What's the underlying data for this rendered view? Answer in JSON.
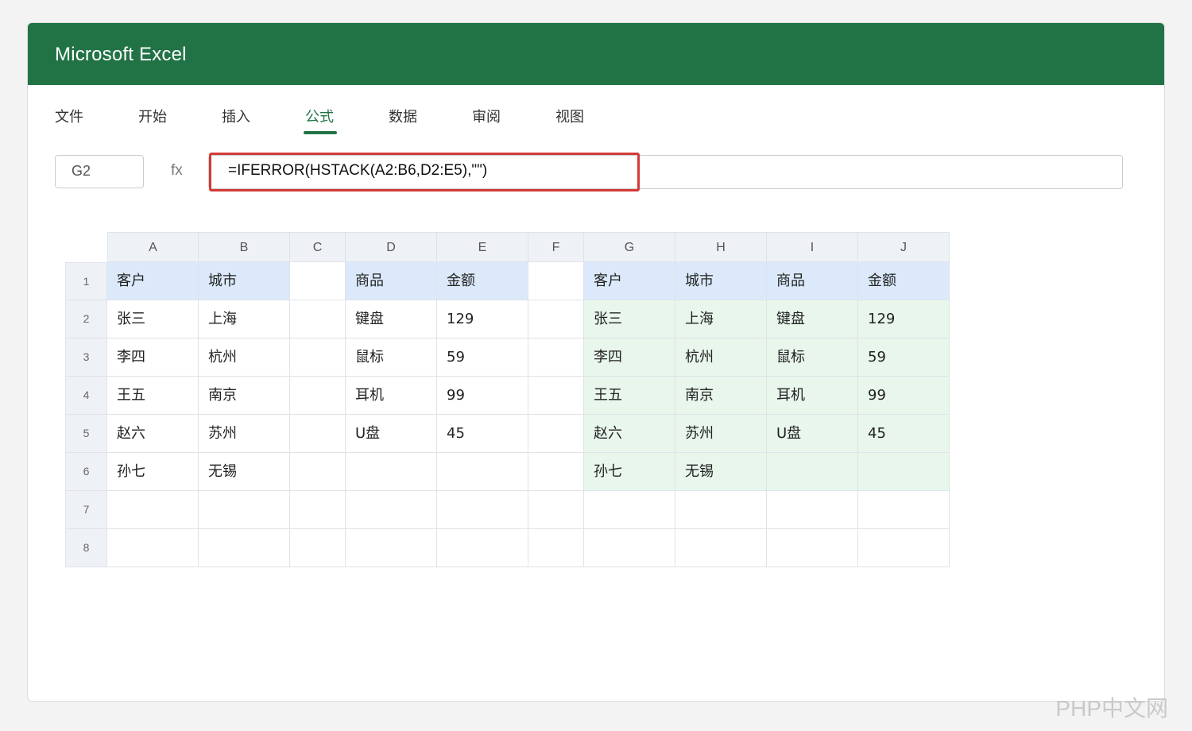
{
  "app": {
    "title": "Microsoft Excel"
  },
  "ribbon": {
    "tabs": [
      {
        "label": "文件"
      },
      {
        "label": "开始"
      },
      {
        "label": "插入"
      },
      {
        "label": "公式",
        "active": true
      },
      {
        "label": "数据"
      },
      {
        "label": "审阅"
      },
      {
        "label": "视图"
      }
    ]
  },
  "formula": {
    "name_box": "G2",
    "fx_label": "fx",
    "text": "=IFERROR(HSTACK(A2:B6,D2:E5),\"\")"
  },
  "sheet": {
    "columns": [
      "A",
      "B",
      "C",
      "D",
      "E",
      "F",
      "G",
      "H",
      "I",
      "J"
    ],
    "rows": [
      {
        "num": "1",
        "cells": [
          "客户",
          "城市",
          "",
          "商品",
          "金额",
          "",
          "客户",
          "城市",
          "商品",
          "金额"
        ]
      },
      {
        "num": "2",
        "cells": [
          "张三",
          "上海",
          "",
          "键盘",
          "129",
          "",
          "张三",
          "上海",
          "键盘",
          "129"
        ]
      },
      {
        "num": "3",
        "cells": [
          "李四",
          "杭州",
          "",
          "鼠标",
          "59",
          "",
          "李四",
          "杭州",
          "鼠标",
          "59"
        ]
      },
      {
        "num": "4",
        "cells": [
          "王五",
          "南京",
          "",
          "耳机",
          "99",
          "",
          "王五",
          "南京",
          "耳机",
          "99"
        ]
      },
      {
        "num": "5",
        "cells": [
          "赵六",
          "苏州",
          "",
          "U盘",
          "45",
          "",
          "赵六",
          "苏州",
          "U盘",
          "45"
        ]
      },
      {
        "num": "6",
        "cells": [
          "孙七",
          "无锡",
          "",
          "",
          "",
          "",
          "孙七",
          "无锡",
          "",
          ""
        ]
      },
      {
        "num": "7",
        "cells": [
          "",
          "",
          "",
          "",
          "",
          "",
          "",
          "",
          "",
          ""
        ]
      },
      {
        "num": "8",
        "cells": [
          "",
          "",
          "",
          "",
          "",
          "",
          "",
          "",
          "",
          ""
        ]
      }
    ]
  },
  "colors": {
    "accent": "#217346",
    "highlight": "#d33a36",
    "header_fill": "#dbe9fb",
    "result_fill": "#e8f6ec"
  },
  "watermark": "PHP中文网"
}
